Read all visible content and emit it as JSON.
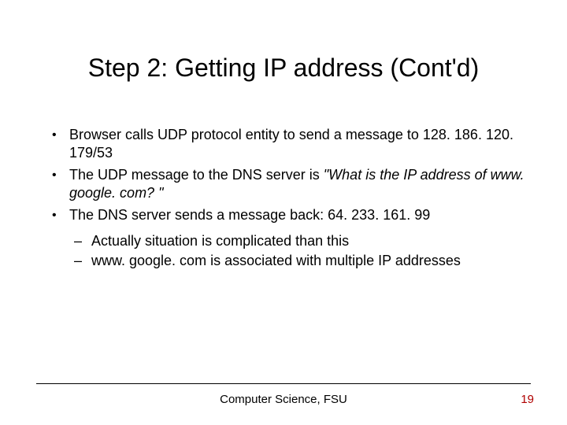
{
  "title": "Step 2: Getting IP address (Cont'd)",
  "bullets": [
    "Browser calls UDP protocol entity to send a message to 128. 186. 120. 179/53",
    {
      "pre": "The UDP message to the DNS server is ",
      "em": "\"What is the IP address of www. google. com? \""
    },
    "The DNS server sends a message back: 64. 233. 161. 99"
  ],
  "subs": [
    "Actually situation is complicated than this",
    "www. google. com is associated with multiple IP addresses"
  ],
  "footer": "Computer Science, FSU",
  "page": "19"
}
